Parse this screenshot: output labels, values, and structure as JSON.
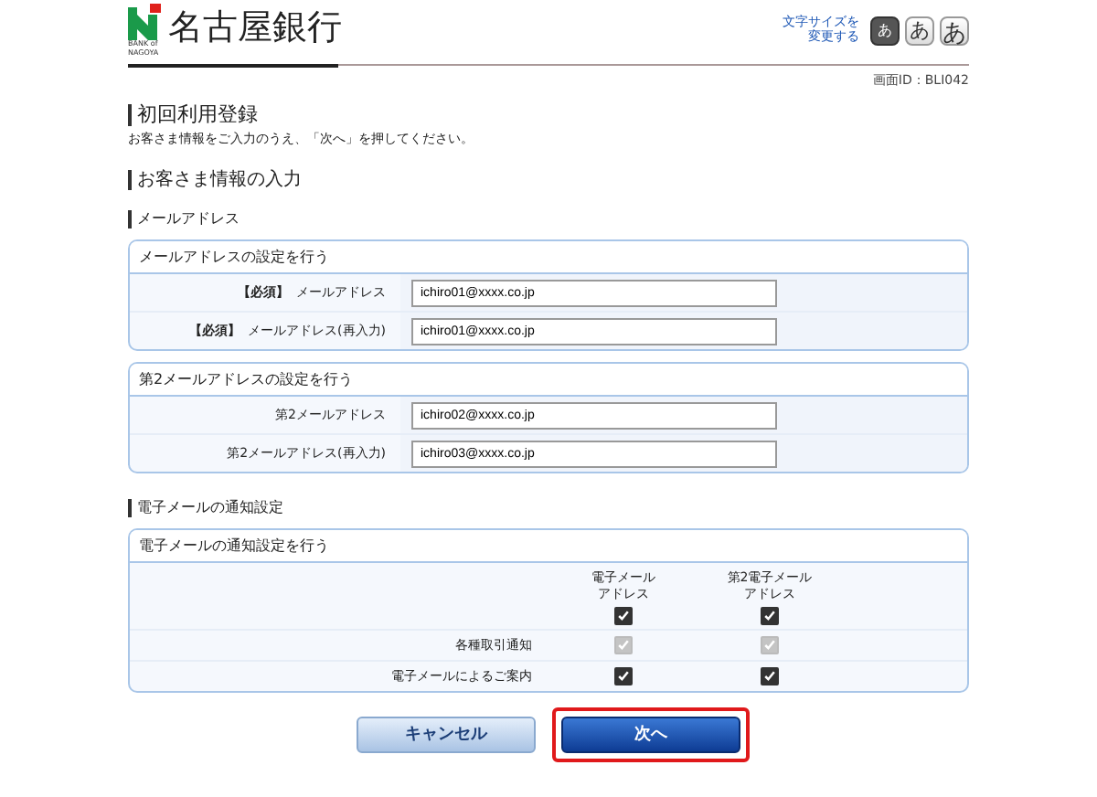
{
  "header": {
    "bank_name": "名古屋銀行",
    "logo_caption": "BANK of NAGOYA",
    "font_size_label": "文字サイズを変更する",
    "font_sizes": [
      {
        "label": "あ",
        "selected": true
      },
      {
        "label": "あ",
        "selected": false
      },
      {
        "label": "あ",
        "selected": false
      }
    ]
  },
  "screen_id": "画面ID：BLI042",
  "page_title": "初回利用登録",
  "instruction": "お客さま情報をご入力のうえ、「次へ」を押してください。",
  "section_title": "お客さま情報の入力",
  "groups": [
    {
      "heading": "メールアドレス",
      "cards": [
        {
          "title": "メールアドレスの設定を行う",
          "fields": [
            {
              "required_tag": "【必須】",
              "label": "メールアドレス",
              "value": "ichiro01@xxxx.co.jp"
            },
            {
              "required_tag": "【必須】",
              "label": "メールアドレス(再入力)",
              "value": "ichiro01@xxxx.co.jp"
            }
          ]
        },
        {
          "title": "第2メールアドレスの設定を行う",
          "fields": [
            {
              "label": "第2メールアドレス",
              "value": "ichiro02@xxxx.co.jp"
            },
            {
              "label": "第2メールアドレス(再入力)",
              "value": "ichiro03@xxxx.co.jp"
            }
          ]
        }
      ]
    }
  ],
  "notification": {
    "heading": "電子メールの通知設定",
    "card_title": "電子メールの通知設定を行う",
    "columns": [
      {
        "label": "電子メールアドレス",
        "checked": true
      },
      {
        "label": "第2電子メールアドレス",
        "checked": true
      }
    ],
    "rows": [
      {
        "label": "各種取引通知",
        "cells": [
          {
            "checked": true,
            "disabled": true
          },
          {
            "checked": true,
            "disabled": true
          }
        ]
      },
      {
        "label": "電子メールによるご案内",
        "cells": [
          {
            "checked": true,
            "disabled": false
          },
          {
            "checked": true,
            "disabled": false
          }
        ]
      }
    ]
  },
  "buttons": [
    {
      "kind": "secondary",
      "label": "キャンセル",
      "highlighted": false
    },
    {
      "kind": "primary",
      "label": "次へ",
      "highlighted": true
    }
  ]
}
